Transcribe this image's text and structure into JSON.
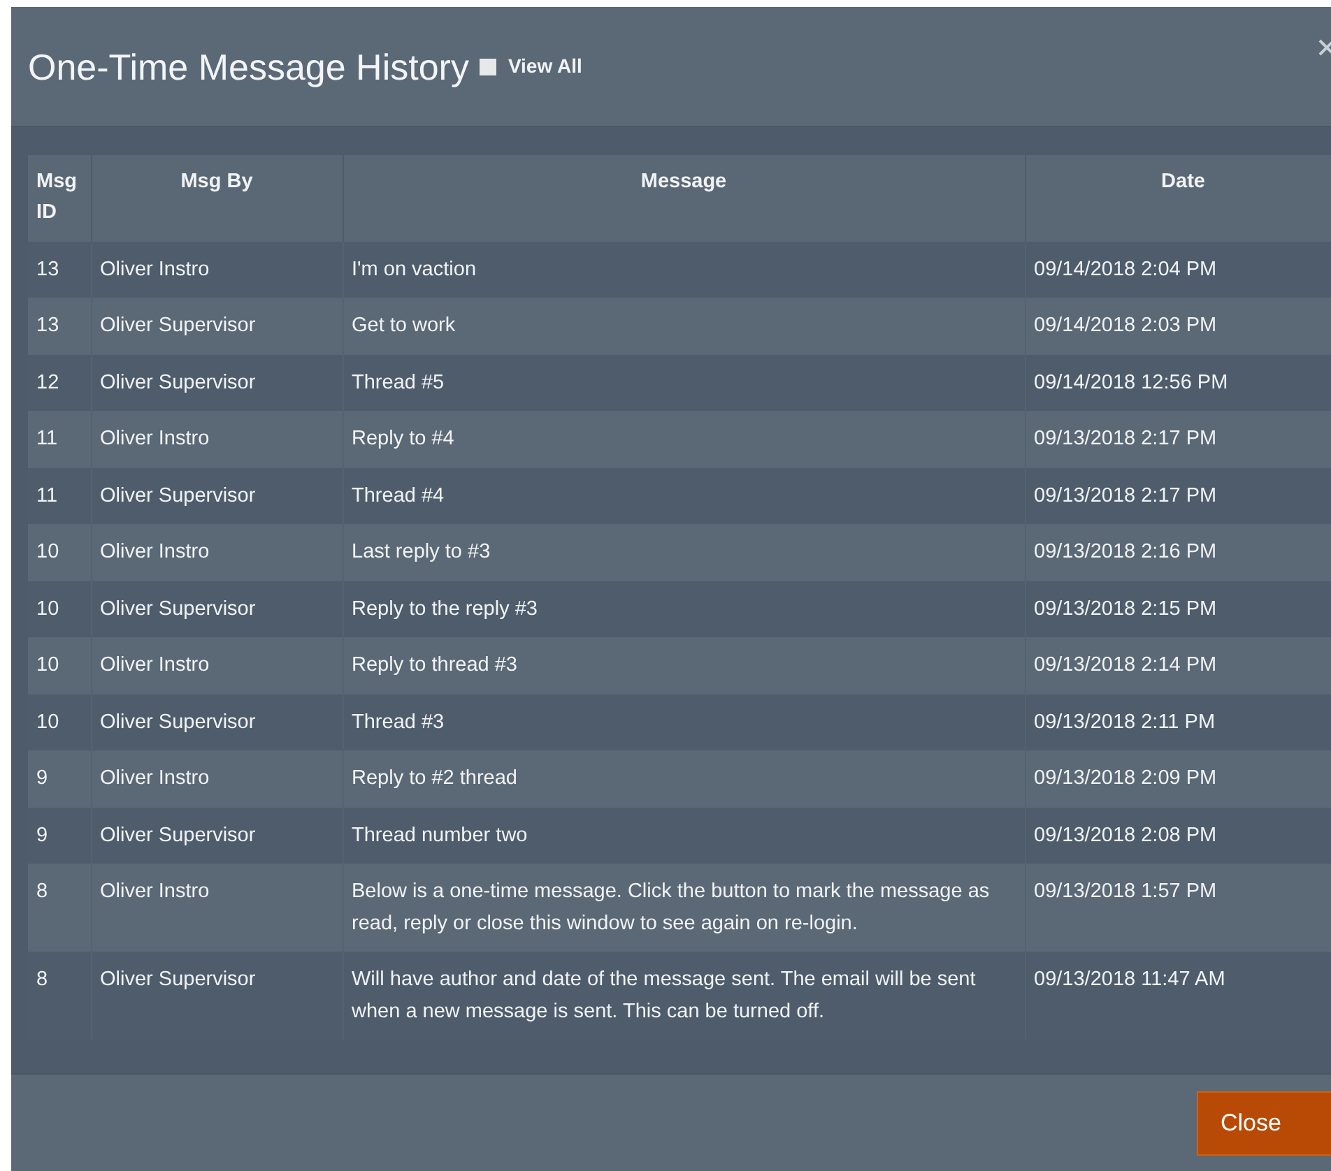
{
  "dialog": {
    "title": "One-Time Message History",
    "view_all": {
      "label": "View All",
      "checked": false
    }
  },
  "table": {
    "columns": [
      "Msg ID",
      "Msg By",
      "Message",
      "Date"
    ],
    "rows": [
      {
        "id": "13",
        "by": "Oliver Instro",
        "message": "I'm on vaction",
        "date": "09/14/2018 2:04 PM"
      },
      {
        "id": "13",
        "by": "Oliver Supervisor",
        "message": "Get to work",
        "date": "09/14/2018 2:03 PM"
      },
      {
        "id": "12",
        "by": "Oliver Supervisor",
        "message": "Thread #5",
        "date": "09/14/2018 12:56 PM"
      },
      {
        "id": "11",
        "by": "Oliver Instro",
        "message": "Reply to #4",
        "date": "09/13/2018 2:17 PM"
      },
      {
        "id": "11",
        "by": "Oliver Supervisor",
        "message": "Thread #4",
        "date": "09/13/2018 2:17 PM"
      },
      {
        "id": "10",
        "by": "Oliver Instro",
        "message": "Last reply to #3",
        "date": "09/13/2018 2:16 PM"
      },
      {
        "id": "10",
        "by": "Oliver Supervisor",
        "message": "Reply to the reply #3",
        "date": "09/13/2018 2:15 PM"
      },
      {
        "id": "10",
        "by": "Oliver Instro",
        "message": "Reply to thread #3",
        "date": "09/13/2018 2:14 PM"
      },
      {
        "id": "10",
        "by": "Oliver Supervisor",
        "message": "Thread #3",
        "date": "09/13/2018 2:11 PM"
      },
      {
        "id": "9",
        "by": "Oliver Instro",
        "message": "Reply to #2 thread",
        "date": "09/13/2018 2:09 PM"
      },
      {
        "id": "9",
        "by": "Oliver Supervisor",
        "message": "Thread number two",
        "date": "09/13/2018 2:08 PM"
      },
      {
        "id": "8",
        "by": "Oliver Instro",
        "message": "Below is a one-time message. Click the button to mark the message as read, reply or close this window to see again on re-login.",
        "date": "09/13/2018 1:57 PM"
      },
      {
        "id": "8",
        "by": "Oliver Supervisor",
        "message": "Will have author and date of the message sent. The email will be sent when a new message is sent. This can be turned off.",
        "date": "09/13/2018 11:47 AM"
      }
    ]
  },
  "buttons": [
    "Close"
  ]
}
